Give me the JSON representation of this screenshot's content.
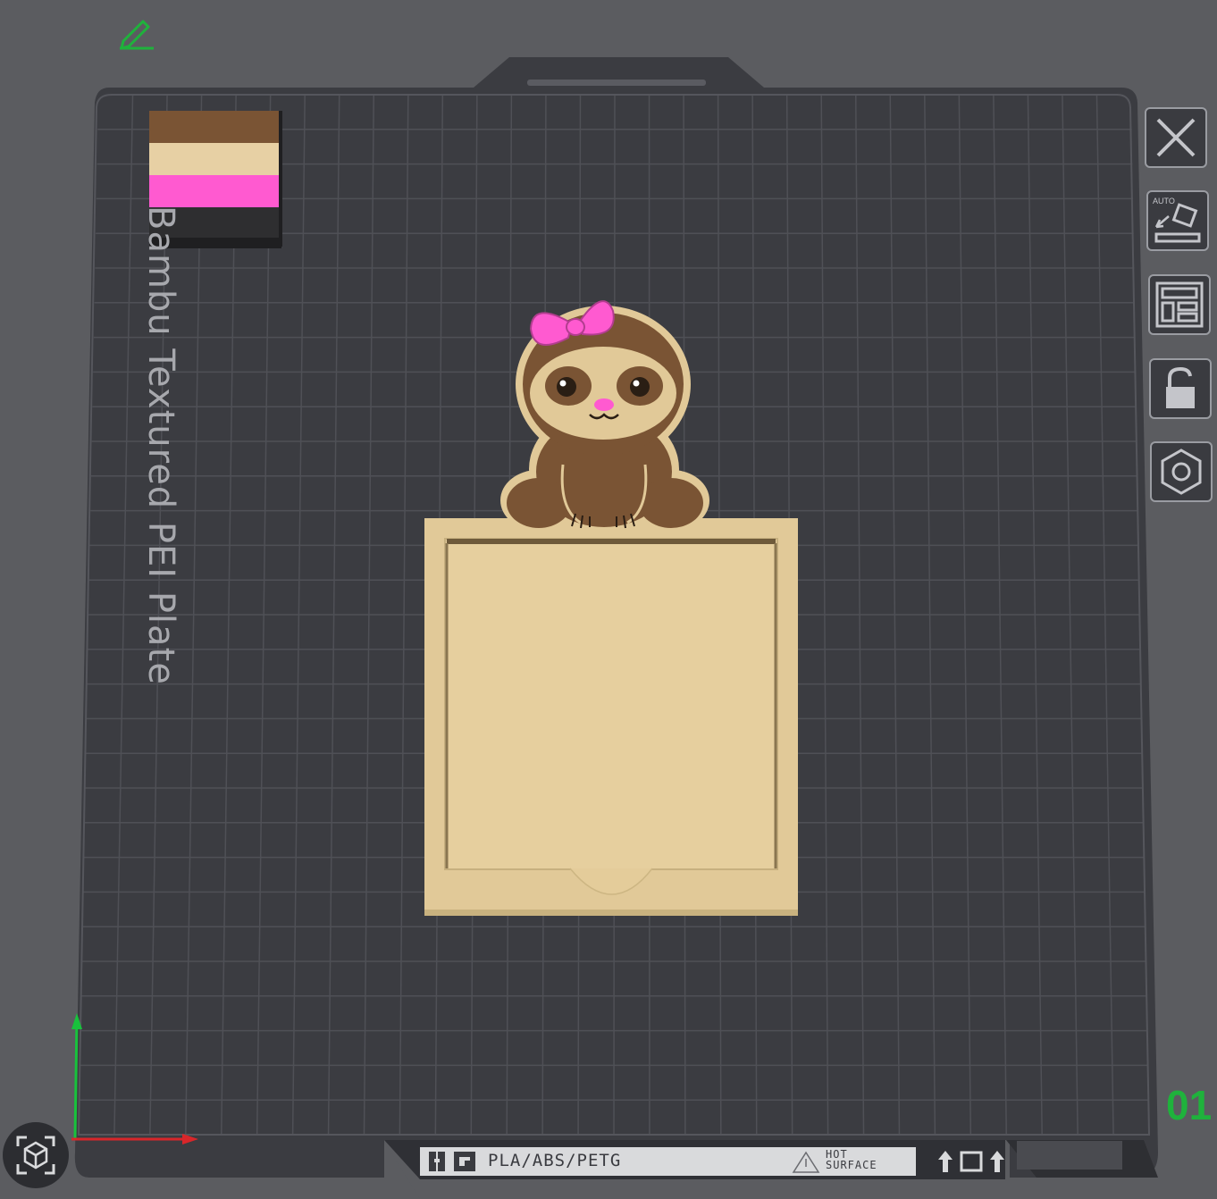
{
  "plate": {
    "label": "Bambu Textured PEI Plate",
    "number": "01",
    "material_label": "PLA/ABS/PETG",
    "hot_surface_line1": "HOT",
    "hot_surface_line2": "SURFACE"
  },
  "toolbar": {
    "items": [
      {
        "name": "close",
        "icon": "close-icon"
      },
      {
        "name": "auto-orient",
        "icon": "auto-orient-icon",
        "badge": "AUTO"
      },
      {
        "name": "arrange",
        "icon": "arrange-icon"
      },
      {
        "name": "lock",
        "icon": "lock-icon"
      },
      {
        "name": "plate-settings",
        "icon": "hexagon-nut-icon"
      }
    ]
  },
  "filament_colors": [
    "#7a5434",
    "#e7d0a4",
    "#ff5ad0",
    "#2e2e30"
  ],
  "colors": {
    "background": "#5b5c60",
    "plate": "#3b3c41",
    "grid": "#4d4e54",
    "accent_green": "#1fb23c",
    "model_tan": "#e1c998",
    "model_brown": "#7a5434",
    "model_pink": "#ff5ad0"
  }
}
